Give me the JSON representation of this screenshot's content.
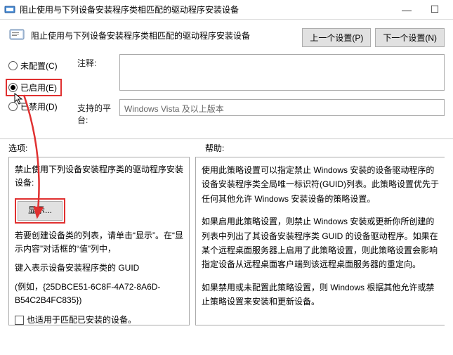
{
  "window": {
    "title": "阻止使用与下列设备安装程序类相匹配的驱动程序安装设备"
  },
  "header": {
    "title": "阻止使用与下列设备安装程序类相匹配的驱动程序安装设备",
    "prev_button": "上一个设置(P)",
    "next_button": "下一个设置(N)"
  },
  "radios": {
    "not_configured": "未配置(C)",
    "enabled": "已启用(E)",
    "disabled": "已禁用(D)"
  },
  "fields": {
    "comment_label": "注释:",
    "platform_label": "支持的平台:",
    "platform_value": "Windows Vista 及以上版本"
  },
  "mid": {
    "options_label": "选项:",
    "help_label": "帮助:"
  },
  "left_pane": {
    "p1": "禁止使用下列设备安装程序类的驱动程序安装设备:",
    "show_button": "显示...",
    "p2": "若要创建设备类的列表，请单击“显示”。在“显示内容”对话框的“值”列中，",
    "p3": "键入表示设备安装程序类的 GUID",
    "p4": "(例如，{25DBCE51-6C8F-4A72-8A6D-B54C2B4FC835})",
    "checkbox_label": "也适用于匹配已安装的设备。"
  },
  "right_pane": {
    "p1": "使用此策略设置可以指定禁止 Windows 安装的设备驱动程序的设备安装程序类全局唯一标识符(GUID)列表。此策略设置优先于任何其他允许 Windows 安装设备的策略设置。",
    "p2": "如果启用此策略设置，则禁止 Windows 安装或更新你所创建的列表中列出了其设备安装程序类 GUID 的设备驱动程序。如果在某个远程桌面服务器上启用了此策略设置，则此策略设置会影响指定设备从远程桌面客户端到该远程桌面服务器的重定向。",
    "p3": "如果禁用或未配置此策略设置，则 Windows 根据其他允许或禁止策略设置来安装和更新设备。"
  }
}
